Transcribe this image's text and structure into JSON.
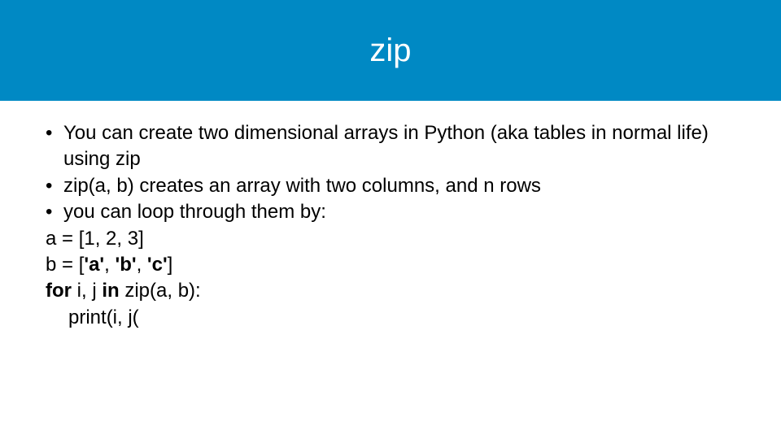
{
  "title": "zip",
  "bullets": [
    "You can create two dimensional arrays in Python (aka tables in normal life) using zip",
    "zip(a, b) creates an array with two columns, and n rows",
    "you can loop through them by:"
  ],
  "code": {
    "line1_a": "a = [1, 2, 3]",
    "line2_a": "b = [",
    "line2_b": "'a'",
    "line2_c": ", ",
    "line2_d": "'b'",
    "line2_e": ", ",
    "line2_f": "'c'",
    "line2_g": "]",
    "line3_a": "for ",
    "line3_b": "i, j ",
    "line3_c": "in ",
    "line3_d": "zip(a, b):",
    "line4_a": "print(i, j("
  },
  "bullet_glyph": "•"
}
